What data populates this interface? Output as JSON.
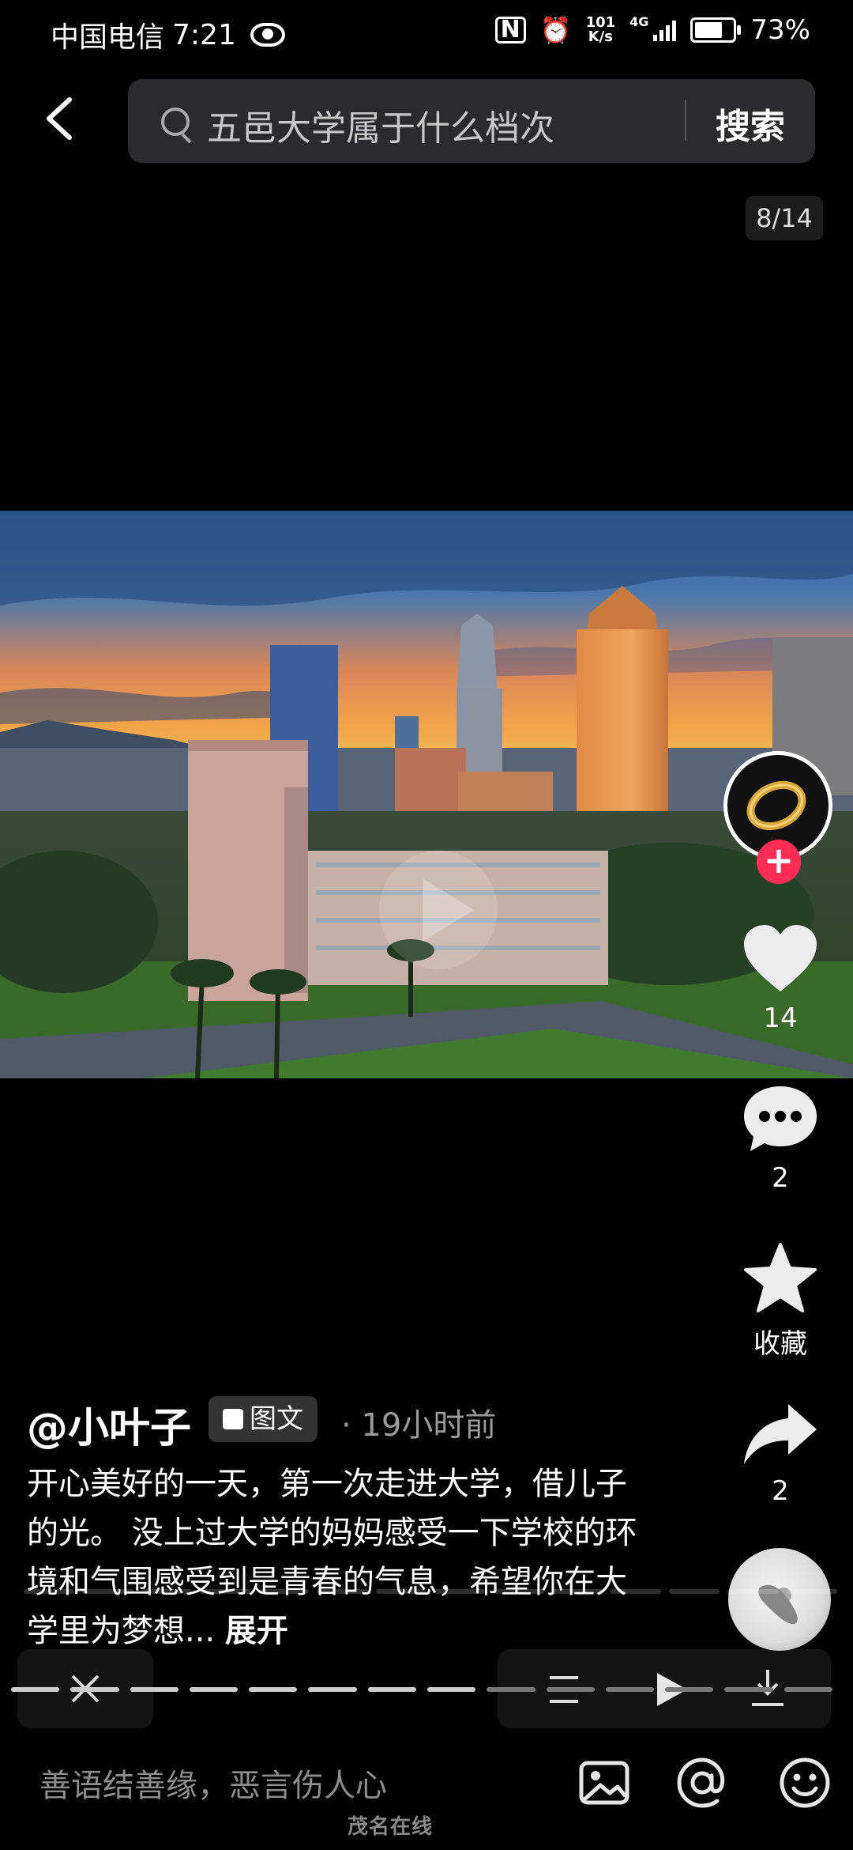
{
  "status_bar": {
    "carrier": "中国电信",
    "time": "7:21",
    "net_speed_value": "101",
    "net_speed_unit": "K/s",
    "network": "4G",
    "battery": "73%",
    "battery_level": 0.73
  },
  "search": {
    "query": "五邑大学属于什么档次",
    "button_label": "搜索"
  },
  "pager": "8/14",
  "post": {
    "author": "@小叶子",
    "type_tag": "图文",
    "time_ago": "· 19小时前",
    "caption": "开心美好的一天，第一次走进大学，借儿子的光。 没上过大学的妈妈感受一下学校的环境和气围感受到是青春的气息，希望你在大学里为梦想...",
    "expand_label": "展开"
  },
  "actions": {
    "like_count": "14",
    "comment_count": "2",
    "favorite_label": "收藏",
    "share_count": "2"
  },
  "comment_bar": {
    "placeholder": "善语结善缘，恶言伤人心"
  },
  "watermark": "茂名在线",
  "icons": [
    "back-icon",
    "search-icon",
    "heart-icon",
    "comment-icon",
    "star-icon",
    "share-icon",
    "image-icon",
    "at-icon",
    "emoji-icon",
    "close-icon",
    "list-icon",
    "play-icon",
    "download-icon"
  ]
}
